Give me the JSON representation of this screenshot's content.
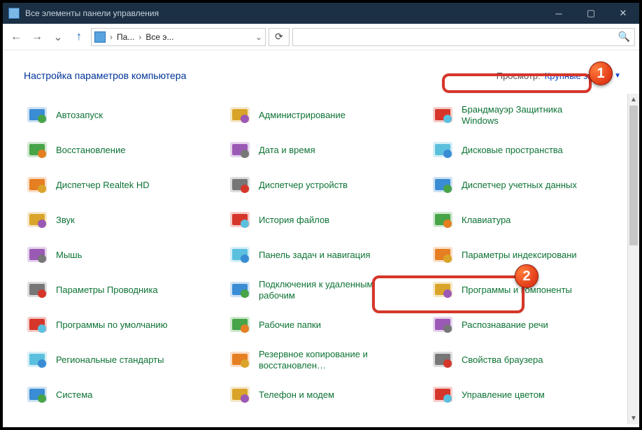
{
  "window": {
    "title": "Все элементы панели управления"
  },
  "breadcrumb": {
    "part1": "Па...",
    "part2": "Все э..."
  },
  "header": {
    "title": "Настройка параметров компьютера",
    "view_label": "Просмотр:",
    "view_value": "Крупные значки"
  },
  "items": [
    {
      "label": "Автозапуск",
      "icon": "autoplay-icon"
    },
    {
      "label": "Администрирование",
      "icon": "admin-tools-icon"
    },
    {
      "label": "Брандмауэр Защитника Windows",
      "icon": "firewall-icon"
    },
    {
      "label": "Восстановление",
      "icon": "recovery-icon"
    },
    {
      "label": "Дата и время",
      "icon": "datetime-icon"
    },
    {
      "label": "Дисковые пространства",
      "icon": "storage-spaces-icon"
    },
    {
      "label": "Диспетчер Realtek HD",
      "icon": "realtek-icon"
    },
    {
      "label": "Диспетчер устройств",
      "icon": "device-manager-icon"
    },
    {
      "label": "Диспетчер учетных данных",
      "icon": "credentials-icon"
    },
    {
      "label": "Звук",
      "icon": "sound-icon"
    },
    {
      "label": "История файлов",
      "icon": "file-history-icon"
    },
    {
      "label": "Клавиатура",
      "icon": "keyboard-icon"
    },
    {
      "label": "Мышь",
      "icon": "mouse-icon"
    },
    {
      "label": "Панель задач и навигация",
      "icon": "taskbar-icon"
    },
    {
      "label": "Параметры индексировани",
      "icon": "indexing-icon"
    },
    {
      "label": "Параметры Проводника",
      "icon": "explorer-options-icon"
    },
    {
      "label": "Подключения к удаленным рабочим",
      "icon": "remote-app-icon"
    },
    {
      "label": "Программы и компоненты",
      "icon": "programs-icon"
    },
    {
      "label": "Программы по умолчанию",
      "icon": "defaults-icon"
    },
    {
      "label": "Рабочие папки",
      "icon": "work-folders-icon"
    },
    {
      "label": "Распознавание речи",
      "icon": "speech-icon"
    },
    {
      "label": "Региональные стандарты",
      "icon": "region-icon"
    },
    {
      "label": "Резервное копирование и восстановлен…",
      "icon": "backup-icon"
    },
    {
      "label": "Свойства браузера",
      "icon": "internet-options-icon"
    },
    {
      "label": "Система",
      "icon": "system-icon"
    },
    {
      "label": "Телефон и модем",
      "icon": "phone-modem-icon"
    },
    {
      "label": "Управление цветом",
      "icon": "color-mgmt-icon"
    }
  ],
  "annotations": {
    "badge1": "1",
    "badge2": "2"
  }
}
